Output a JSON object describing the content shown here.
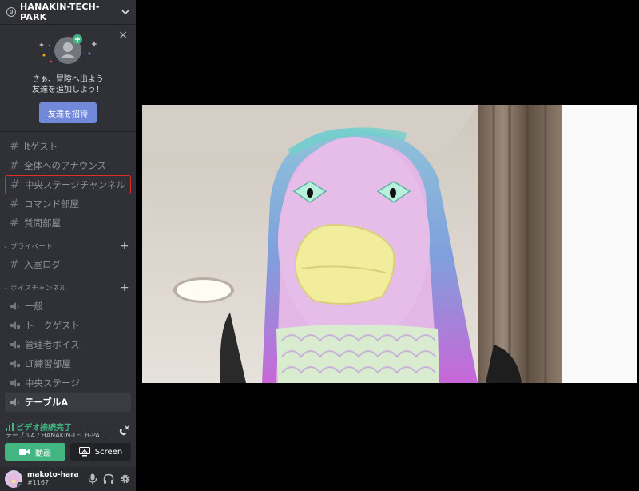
{
  "server": {
    "name": "HANAKIN-TECH-PARK"
  },
  "invite": {
    "message_line1": "さぁ、冒険へ出よう",
    "message_line2": "友達を追加しよう！",
    "button_label": "友達を招待"
  },
  "text_channels": [
    {
      "name": "ltゲスト"
    },
    {
      "name": "全体へのアナウンス"
    },
    {
      "name": "中央ステージチャンネル"
    },
    {
      "name": "コマンド部屋"
    },
    {
      "name": "質問部屋"
    }
  ],
  "private_category": {
    "label": "プライベート",
    "channels": [
      {
        "name": "入室ログ"
      }
    ]
  },
  "voice_category": {
    "label": "ボイスチャンネル",
    "channels": [
      {
        "name": "一般"
      },
      {
        "name": "トークゲスト"
      },
      {
        "name": "管理者ボイス"
      },
      {
        "name": "LT練習部屋"
      },
      {
        "name": "中央ステージ"
      },
      {
        "name": "テーブルA"
      }
    ]
  },
  "voice_status": {
    "title": "ビデオ接続完了",
    "subtitle": "テーブルA / HANAKIN-TECH-PA..."
  },
  "voice_buttons": {
    "video": "動画",
    "screen": "Screen"
  },
  "user": {
    "name": "makoto-hara",
    "tag": "#1167"
  },
  "colors": {
    "accent": "#7289da",
    "online": "#43b581",
    "highlight_border": "#e02b2b"
  }
}
